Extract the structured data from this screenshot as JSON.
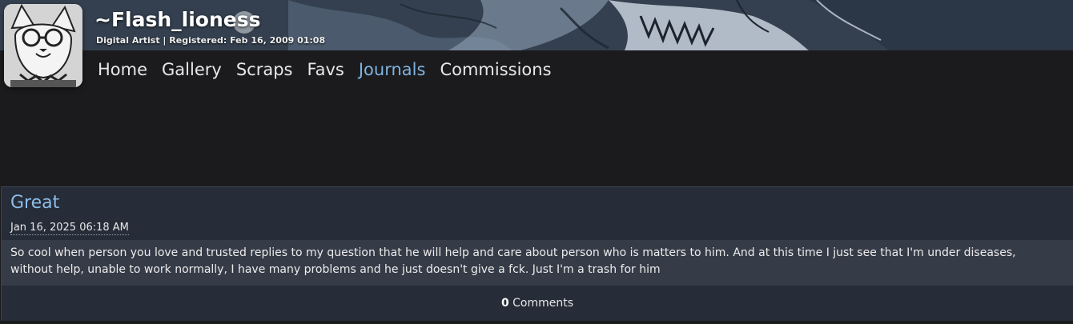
{
  "profile": {
    "username": "~Flash_lioness",
    "meta": "Digital Artist | Registered: Feb 16, 2009 01:08"
  },
  "nav": {
    "items": [
      {
        "label": "Home"
      },
      {
        "label": "Gallery"
      },
      {
        "label": "Scraps"
      },
      {
        "label": "Favs"
      },
      {
        "label": "Journals",
        "active": true
      },
      {
        "label": "Commissions"
      }
    ]
  },
  "journal": {
    "title": "Great",
    "date": "Jan 16, 2025 06:18 AM",
    "body": "So cool when person you love and trusted replies to my question that he will help and care about person who is matters to him. And at this time I just see that I'm under diseases, without help, unable to work normally, I have many problems and he just doesn't give a fck. Just I'm a trash for him",
    "comment_count": "0",
    "comments_label": "Comments"
  },
  "colors": {
    "accent_link": "#7fb3e0",
    "background": "#1b1b1d",
    "panel": "#262c38",
    "panel_body": "#353b47"
  },
  "icons": {
    "avatar": "avatar-illustration",
    "banner": "banner-artwork"
  }
}
